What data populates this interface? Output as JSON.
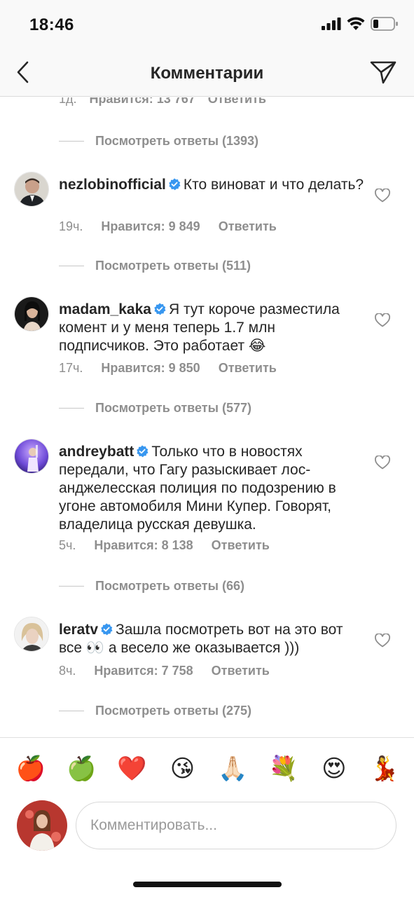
{
  "status": {
    "time": "18:46"
  },
  "header": {
    "title": "Комментарии"
  },
  "top_partial": {
    "timestamp": "1д.",
    "likes": "Нравится: 13 767",
    "reply": "Ответить"
  },
  "top_replies": "Посмотреть ответы (1393)",
  "comments": [
    {
      "username": "nezlobinofficial",
      "text": "Кто виноват и что делать?",
      "timestamp": "19ч.",
      "likes": "Нравится: 9 849",
      "reply": "Ответить",
      "view_replies": "Посмотреть ответы (511)"
    },
    {
      "username": "madam_kaka",
      "text": "Я тут короче разместила комент и у меня теперь 1.7 млн подписчиков. Это работает 😂",
      "timestamp": "17ч.",
      "likes": "Нравится: 9 850",
      "reply": "Ответить",
      "view_replies": "Посмотреть ответы (577)"
    },
    {
      "username": "andreybatt",
      "text": "Только что в новостях передали, что Гагу разыскивает лос-анджелесская полиция по подозрению в угоне автомобиля Мини Купер. Говорят, владелица русская девушка.",
      "timestamp": "5ч.",
      "likes": "Нравится: 8 138",
      "reply": "Ответить",
      "view_replies": "Посмотреть ответы (66)"
    },
    {
      "username": "leratv",
      "text": "Зашла посмотреть вот на это вот все 👀 а весело же оказывается )))",
      "timestamp": "8ч.",
      "likes": "Нравится: 7 758",
      "reply": "Ответить",
      "view_replies": "Посмотреть ответы (275)"
    }
  ],
  "quick_emojis": [
    "🍎",
    "🍏",
    "❤️",
    "😘",
    "🙏🏻",
    "💐",
    "😍",
    "💃"
  ],
  "compose": {
    "placeholder": "Комментировать..."
  },
  "colors": {
    "verified": "#3897f0",
    "secondary_text": "#8e8e8e",
    "primary_text": "#262626"
  }
}
